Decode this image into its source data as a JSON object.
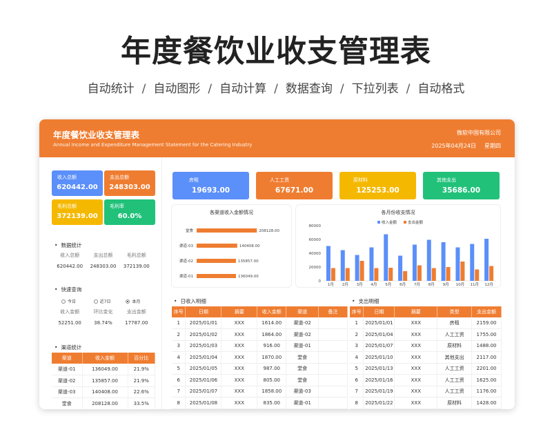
{
  "hero": {
    "title": "年度餐饮业收支管理表",
    "features": [
      "自动统计",
      "自动图形",
      "自动计算",
      "数据查询",
      "下拉列表",
      "自动格式"
    ]
  },
  "header": {
    "title": "年度餐饮业收支管理表",
    "subtitle": "Annual Income and Expenditure Management Statement for the Catering Industry",
    "company": "微软中国有限公司",
    "date": "2025年04月24日",
    "weekday": "星期四"
  },
  "summary": {
    "income_label": "收入总额",
    "income_value": "620442.00",
    "expense_label": "支出总额",
    "expense_value": "248303.00",
    "profit_label": "毛利总额",
    "profit_value": "372139.00",
    "margin_label": "毛利率",
    "margin_value": "60.0%"
  },
  "data_stats": {
    "title": "数据统计",
    "headers": [
      "收入总额",
      "支出总额",
      "毛利总额"
    ],
    "values": [
      "620442.00",
      "248303.00",
      "372139.00"
    ]
  },
  "quick_query": {
    "title": "快速查询",
    "options": [
      "今日",
      "近7日",
      "本月"
    ],
    "selected": "本月",
    "headers": [
      "收入金额",
      "环比变化",
      "支出金额"
    ],
    "values": [
      "52251.00",
      "38.74%",
      "17787.00"
    ]
  },
  "channel_stats": {
    "title": "渠道统计",
    "headers": [
      "渠道",
      "收入金额",
      "百分比"
    ],
    "rows": [
      [
        "渠道-01",
        "136049.00",
        "21.9%"
      ],
      [
        "渠道-02",
        "135857.00",
        "21.9%"
      ],
      [
        "渠道-03",
        "140408.00",
        "22.6%"
      ],
      [
        "堂食",
        "208128.00",
        "33.5%"
      ]
    ]
  },
  "cost_cards": [
    {
      "label": "房租",
      "value": "19693.00",
      "color": "#5b8ff9"
    },
    {
      "label": "人工工资",
      "value": "67671.00",
      "color": "#ef7d31"
    },
    {
      "label": "原材料",
      "value": "125253.00",
      "color": "#f5b800"
    },
    {
      "label": "其他支出",
      "value": "35686.00",
      "color": "#21c17a"
    }
  ],
  "colors": {
    "orange": "#ef7d31",
    "blue": "#5b8ff9",
    "yellow": "#f5b800",
    "green": "#21c17a"
  },
  "chart_data": [
    {
      "type": "bar",
      "title": "各渠道收入金额情况",
      "orientation": "horizontal",
      "categories": [
        "堂食",
        "渠道-03",
        "渠道-02",
        "渠道-01"
      ],
      "values": [
        208128.0,
        140408.0,
        135857.0,
        136049.0
      ],
      "data_labels": [
        "208128.00",
        "140408.00",
        "135857.00",
        "136049.00"
      ],
      "color": "#ef7d31"
    },
    {
      "type": "bar",
      "title": "各月份收支情况",
      "categories": [
        "1月",
        "2月",
        "3月",
        "4月",
        "5月",
        "6月",
        "7月",
        "8月",
        "9月",
        "10月",
        "11月",
        "12月"
      ],
      "series": [
        {
          "name": "收入金额",
          "color": "#5b8ff9",
          "values": [
            50500,
            44500,
            37500,
            48500,
            67500,
            36500,
            52500,
            59500,
            56000,
            48500,
            53500,
            61000
          ]
        },
        {
          "name": "支出金额",
          "color": "#ef7d31",
          "values": [
            18500,
            18500,
            29000,
            18500,
            19000,
            14000,
            22500,
            18500,
            20000,
            28000,
            16500,
            21500
          ]
        }
      ],
      "ylim": [
        0,
        80000
      ],
      "yticks": [
        "0",
        "20000",
        "40000",
        "60000",
        "80000"
      ],
      "legend": "top"
    }
  ],
  "income_list": {
    "title": "日收入明细",
    "headers": [
      "序号",
      "日期",
      "摘要",
      "收入金额",
      "渠道",
      "备注"
    ],
    "rows": [
      [
        "1",
        "2025/01/01",
        "XXX",
        "1614.00",
        "渠道-02",
        ""
      ],
      [
        "2",
        "2025/01/02",
        "XXX",
        "1864.00",
        "渠道-02",
        ""
      ],
      [
        "3",
        "2025/01/03",
        "XXX",
        "916.00",
        "渠道-01",
        ""
      ],
      [
        "4",
        "2025/01/04",
        "XXX",
        "1870.00",
        "堂食",
        ""
      ],
      [
        "5",
        "2025/01/05",
        "XXX",
        "987.00",
        "堂食",
        ""
      ],
      [
        "6",
        "2025/01/06",
        "XXX",
        "805.00",
        "堂食",
        ""
      ],
      [
        "7",
        "2025/01/07",
        "XXX",
        "1858.00",
        "渠道-03",
        ""
      ],
      [
        "8",
        "2025/01/08",
        "XXX",
        "835.00",
        "渠道-01",
        ""
      ]
    ]
  },
  "expense_list": {
    "title": "支出明细",
    "headers": [
      "序号",
      "日期",
      "摘要",
      "类型",
      "支出金额"
    ],
    "rows": [
      [
        "1",
        "2025/01/01",
        "XXX",
        "房租",
        "2159.00"
      ],
      [
        "2",
        "2025/01/04",
        "XXX",
        "人工工资",
        "1755.00"
      ],
      [
        "3",
        "2025/01/07",
        "XXX",
        "原材料",
        "1488.00"
      ],
      [
        "4",
        "2025/01/10",
        "XXX",
        "其他支出",
        "2117.00"
      ],
      [
        "5",
        "2025/01/13",
        "XXX",
        "人工工资",
        "2201.00"
      ],
      [
        "6",
        "2025/01/16",
        "XXX",
        "人工工资",
        "1625.00"
      ],
      [
        "7",
        "2025/01/19",
        "XXX",
        "人工工资",
        "1176.00"
      ],
      [
        "8",
        "2025/01/22",
        "XXX",
        "原材料",
        "1428.00"
      ]
    ]
  }
}
